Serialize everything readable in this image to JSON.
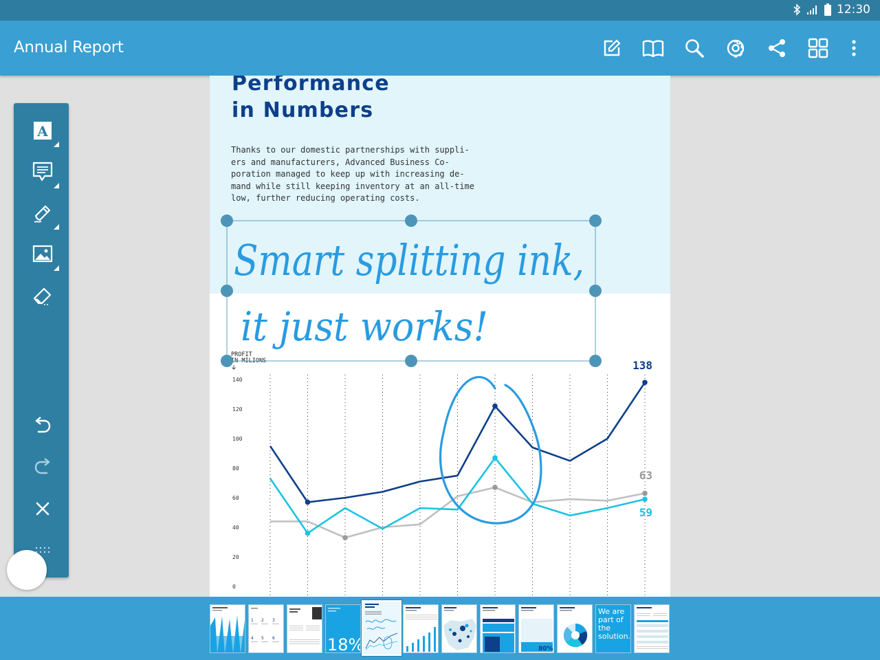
{
  "status_bar": {
    "time": "12:30"
  },
  "app_bar": {
    "title": "Annual Report",
    "actions": [
      "edit-icon",
      "book-icon",
      "search-icon",
      "gear-icon",
      "share-icon",
      "grid-icon",
      "more-vert-icon"
    ]
  },
  "document": {
    "heading_lines": [
      "Performance",
      "in Numbers"
    ],
    "body_lines": [
      "Thanks to our domestic partnerships with suppli-",
      "ers and manufacturers, Advanced Business Co-",
      "poration managed to keep up with increasing de-",
      "mand while still keeping inventory at an all-time",
      "low, further reducing operating costs."
    ],
    "handwriting_lines": [
      "Smart splitting ink,",
      "it just works!"
    ]
  },
  "chart_data": {
    "type": "line",
    "ylabel": "PROFIT\nIN MILIONS",
    "ylim": [
      0,
      140
    ],
    "yticks": [
      0,
      20,
      40,
      60,
      80,
      100,
      120,
      140
    ],
    "x": [
      1,
      2,
      3,
      4,
      5,
      6,
      7,
      8,
      9,
      10,
      11
    ],
    "series": [
      {
        "values": [
          95,
          57,
          60,
          64,
          71,
          75,
          122,
          94,
          85,
          100,
          138
        ],
        "color": "#0d3f8a",
        "end_label": "138",
        "markers": [
          1,
          6,
          10
        ]
      },
      {
        "values": [
          44,
          44,
          33,
          40,
          42,
          61,
          67,
          57,
          59,
          58,
          63
        ],
        "color": "#c0c0c0",
        "end_label": "63",
        "marker_color": "#999999",
        "markers": [
          2,
          6,
          10
        ]
      },
      {
        "values": [
          73,
          36,
          53,
          39,
          53,
          52,
          87,
          56,
          48,
          53,
          59
        ],
        "color": "#1cc3e2",
        "end_label": "59",
        "markers": [
          1,
          6,
          10
        ]
      }
    ]
  },
  "toolbar": {
    "tools": [
      "text-tool-icon",
      "comment-tool-icon",
      "pen-tool-icon",
      "image-tool-icon",
      "eraser-tool-icon"
    ],
    "actions": [
      "undo-icon",
      "redo-icon",
      "close-icon",
      "drag-handle-icon"
    ]
  },
  "thumbnails": {
    "selected_index": 4,
    "labels": [
      "",
      "",
      "",
      "18%",
      "",
      "",
      "",
      "",
      "80%",
      "",
      "We are part of the solution.",
      ""
    ],
    "accent": "#3a9fd3"
  }
}
